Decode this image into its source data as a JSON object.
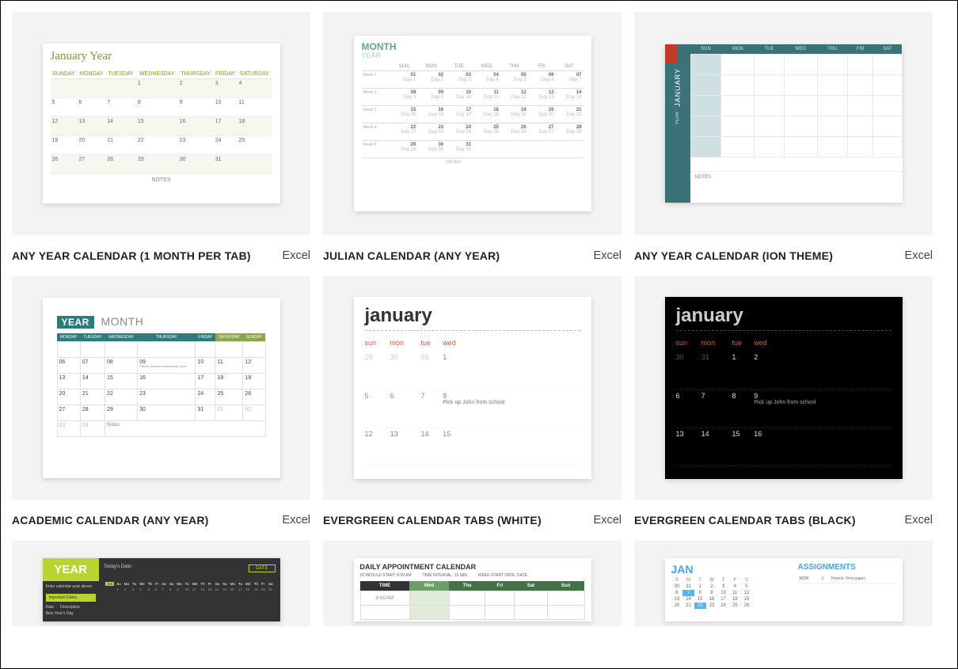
{
  "appLabel": "Excel",
  "cards": [
    {
      "title": "ANY YEAR CALENDAR (1 MONTH PER TAB)"
    },
    {
      "title": "JULIAN CALENDAR (ANY YEAR)"
    },
    {
      "title": "ANY YEAR CALENDAR (ION THEME)"
    },
    {
      "title": "ACADEMIC CALENDAR (ANY YEAR)"
    },
    {
      "title": "EVERGREEN CALENDAR TABS (WHITE)"
    },
    {
      "title": "EVERGREEN CALENDAR TABS (BLACK)"
    }
  ],
  "c1": {
    "heading": "January Year",
    "days": [
      "SUNDAY",
      "MONDAY",
      "TUESDAY",
      "WEDNESDAY",
      "THURSDAY",
      "FRIDAY",
      "SATURDAY"
    ],
    "notes": "NOTES"
  },
  "c2": {
    "month": "MONTH",
    "year": "YEAR",
    "days": [
      "SUN",
      "MON",
      "TUE",
      "WED",
      "THU",
      "FRI",
      "SAT"
    ],
    "notes": "NOTES"
  },
  "c3": {
    "month": "JANUARY",
    "year": "YEAR",
    "days": [
      "SUN",
      "MON",
      "TUE",
      "WED",
      "THU",
      "FRI",
      "SAT"
    ],
    "notes": "NOTES"
  },
  "c4": {
    "year": "YEAR",
    "month": "MONTH",
    "days": [
      "MONDAY",
      "TUESDAY",
      "WEDNESDAY",
      "THURSDAY",
      "FRIDAY",
      "SATURDAY",
      "SUNDAY"
    ],
    "event": "Parent Teacher conferences 7pm",
    "notes": "Notes:"
  },
  "c5": {
    "month": "january",
    "days": [
      "sun",
      "mon",
      "tue",
      "wed"
    ],
    "event": "Pick up John from school"
  },
  "c6": {
    "month": "january",
    "days": [
      "sun",
      "mon",
      "tue",
      "wed"
    ],
    "event": "Pick up John from school"
  },
  "c7": {
    "year": "YEAR",
    "today": "Today's Date:",
    "dateBtn": "DATE",
    "enter": "Enter calendar year above",
    "important": "Important Dates",
    "dateCol": "Date",
    "descCol": "Description",
    "newyear": "New Year's Day",
    "jan": "Jan"
  },
  "c8": {
    "title": "DAILY APPOINTMENT CALENDAR",
    "schedStart": "SCHEDULE START:",
    "schedStartVal": "8:00 AM",
    "interval": "TIME INTERVAL:",
    "intervalVal": "15 MIN",
    "weekStart": "WEEK START DATE:",
    "weekStartVal": "DATE",
    "cols": [
      "TIME",
      "Wed",
      "Thu",
      "Fri",
      "Sat",
      "Sun"
    ],
    "time0": "8:00 AM"
  },
  "c9": {
    "month": "JAN",
    "days": [
      "S",
      "M",
      "T",
      "W",
      "T",
      "F",
      "S"
    ],
    "ah": "ASSIGNMENTS",
    "mon": "MON",
    "anum": "1",
    "adesc": "French: First paper"
  }
}
